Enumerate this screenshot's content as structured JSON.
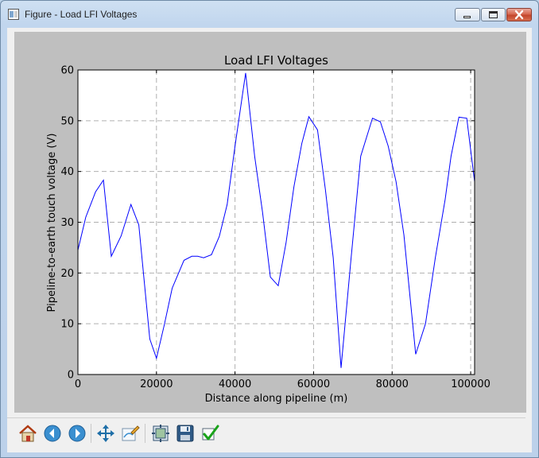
{
  "window": {
    "title": "Figure - Load LFI Voltages"
  },
  "toolbar": {
    "buttons": [
      "home-icon",
      "back-icon",
      "forward-icon",
      "pan-icon",
      "edit-curve-icon",
      "configure-subplots-icon",
      "save-icon",
      "check-icon"
    ]
  },
  "colors": {
    "line": "#0000ff",
    "figure_bg": "#bfbfbf",
    "axes_bg": "#ffffff",
    "grid": "#b0b0b0"
  },
  "chart_data": {
    "type": "line",
    "title": "Load LFI Voltages",
    "xlabel": "Distance along pipeline (m)",
    "ylabel": "Pipeline-to-earth touch voltage (V)",
    "xlim": [
      0,
      101000
    ],
    "ylim": [
      0,
      60
    ],
    "xticks": [
      "0",
      "20000",
      "40000",
      "60000",
      "80000",
      "100000"
    ],
    "yticks": [
      "0",
      "10",
      "20",
      "30",
      "40",
      "50",
      "60"
    ],
    "grid": true,
    "series": [
      {
        "color": "#0000ff",
        "x": [
          0,
          2000,
          4500,
          6500,
          8500,
          11000,
          13500,
          15500,
          18300,
          20000,
          22000,
          24000,
          27000,
          29000,
          30500,
          32000,
          34000,
          36000,
          38000,
          40000,
          42700,
          45000,
          47000,
          49000,
          51000,
          53000,
          55000,
          57000,
          58800,
          61000,
          63000,
          65000,
          67000,
          69500,
          72000,
          75000,
          77000,
          79000,
          81000,
          83000,
          86000,
          88500,
          91000,
          93500,
          95000,
          97000,
          99000,
          101000
        ],
        "y": [
          24.5,
          31,
          36,
          38.3,
          23.3,
          27.3,
          33.5,
          29.5,
          7,
          3.2,
          9.8,
          17,
          22.5,
          23.3,
          23.3,
          23,
          23.6,
          27.2,
          33.5,
          45,
          59.4,
          43,
          32,
          19.2,
          17.5,
          26,
          37,
          45.5,
          50.8,
          48.2,
          36.5,
          23,
          1.3,
          22.5,
          43,
          50.5,
          49.8,
          45,
          38,
          27.5,
          4,
          10,
          23,
          34.5,
          43,
          50.7,
          50.5,
          38
        ]
      }
    ]
  }
}
